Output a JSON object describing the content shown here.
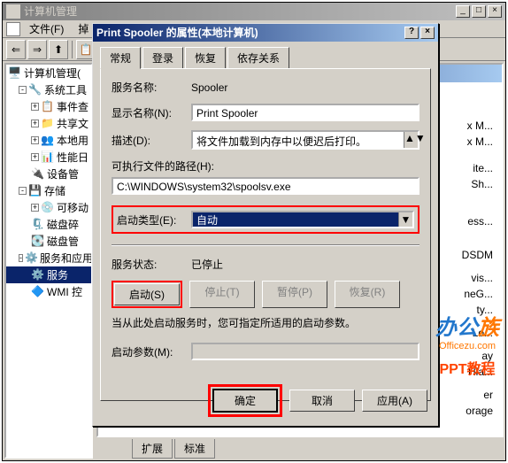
{
  "mmc": {
    "title": "计算机管理",
    "menu": {
      "file": "文件(F)",
      "action": "掉"
    },
    "tree": {
      "root": "计算机管理(",
      "system_tools": "系统工具",
      "event_viewer": "事件查",
      "shared": "共享文",
      "local": "本地用",
      "perf": "性能日",
      "device": "设备管",
      "storage": "存储",
      "removable": "可移动",
      "defrag": "磁盘碎",
      "disk": "磁盘管",
      "services_apps": "服务和应用",
      "services": "服务",
      "wmi": "WMI 控"
    },
    "right_fragments": [
      "x M...",
      "x M...",
      "ite...",
      "Sh...",
      "ess...",
      "DSDM",
      "vis...",
      "neG...",
      "ty...",
      "Lo...",
      "ay",
      "Hia...",
      "er",
      "orage"
    ],
    "tabs": {
      "extended": "扩展",
      "standard": "标准"
    }
  },
  "dialog": {
    "title": "Print Spooler 的属性(本地计算机)",
    "tabs": {
      "general": "常规",
      "logon": "登录",
      "recovery": "恢复",
      "deps": "依存关系"
    },
    "service_name_lbl": "服务名称:",
    "service_name": "Spooler",
    "display_name_lbl": "显示名称(N):",
    "display_name": "Print Spooler",
    "description_lbl": "描述(D):",
    "description": "将文件加载到内存中以便迟后打印。",
    "exe_path_lbl": "可执行文件的路径(H):",
    "exe_path": "C:\\WINDOWS\\system32\\spoolsv.exe",
    "startup_type_lbl": "启动类型(E):",
    "startup_type": "自动",
    "status_lbl": "服务状态:",
    "status": "已停止",
    "start_btn": "启动(S)",
    "stop_btn": "停止(T)",
    "pause_btn": "暂停(P)",
    "resume_btn": "恢复(R)",
    "hint": "当从此处启动服务时，您可指定所适用的启动参数。",
    "start_params_lbl": "启动参数(M):",
    "ok": "确定",
    "cancel": "取消",
    "apply": "应用(A)"
  },
  "watermark": {
    "line1a": "办公",
    "line1b": "族",
    "line2": "Officezu.com",
    "line3": "PPT教程"
  }
}
